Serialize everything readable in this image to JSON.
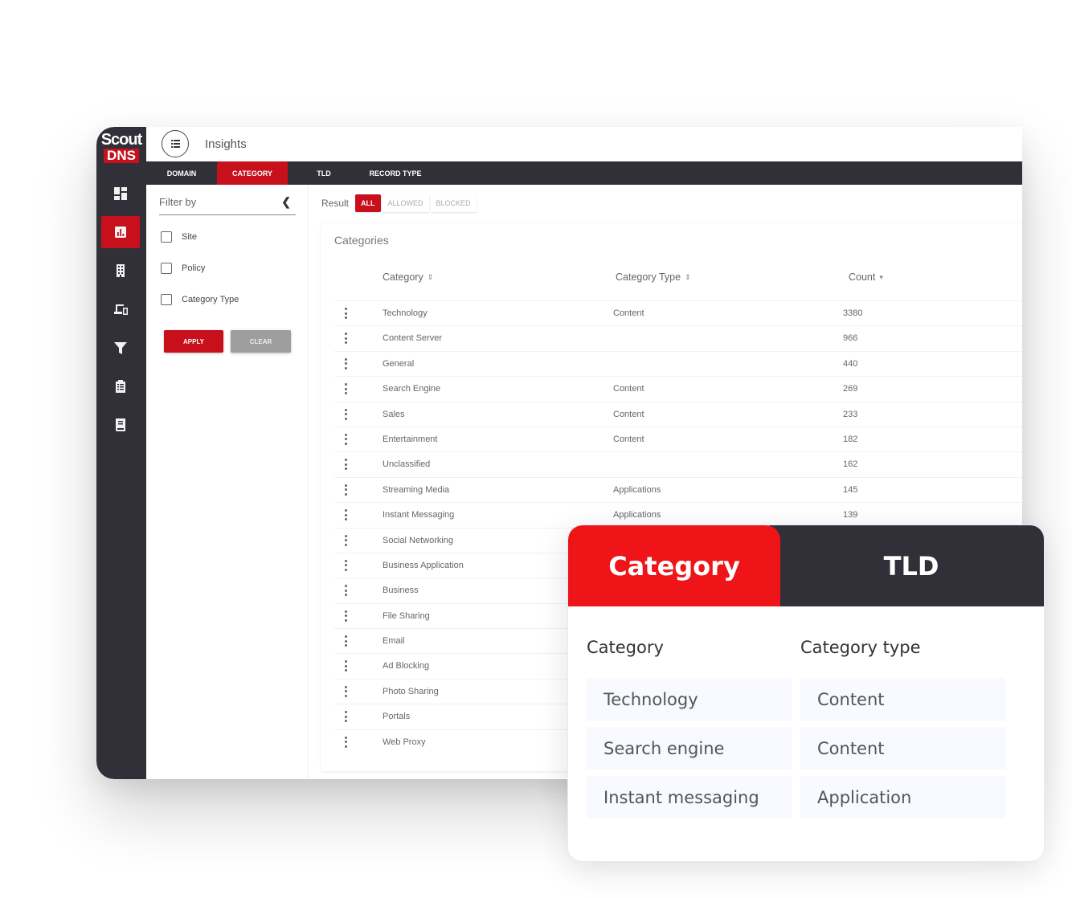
{
  "brand": {
    "name_top": "Scout",
    "name_bottom": "DNS",
    "accent": "#c8101c",
    "dark": "#313038"
  },
  "header": {
    "menu_icon": "list-icon",
    "title": "Insights"
  },
  "tabs": [
    {
      "label": "DOMAIN",
      "active": false
    },
    {
      "label": "CATEGORY",
      "active": true
    },
    {
      "label": "TLD",
      "active": false
    },
    {
      "label": "RECORD TYPE",
      "active": false
    }
  ],
  "sidebar": {
    "items": [
      {
        "icon": "dashboard-icon",
        "active": false
      },
      {
        "icon": "insights-chart-icon",
        "active": true
      },
      {
        "icon": "building-icon",
        "active": false
      },
      {
        "icon": "devices-icon",
        "active": false
      },
      {
        "icon": "filter-icon",
        "active": false
      },
      {
        "icon": "clipboard-list-icon",
        "active": false
      },
      {
        "icon": "book-icon",
        "active": false
      }
    ]
  },
  "filter": {
    "title": "Filter by",
    "collapse_icon": "chevron-left-icon",
    "options": [
      {
        "label": "Site",
        "checked": false
      },
      {
        "label": "Policy",
        "checked": false
      },
      {
        "label": "Category Type",
        "checked": false
      }
    ],
    "apply_label": "APPLY",
    "clear_label": "CLEAR"
  },
  "result": {
    "label": "Result",
    "options": [
      {
        "label": "ALL",
        "active": true
      },
      {
        "label": "ALLOWED",
        "active": false
      },
      {
        "label": "BLOCKED",
        "active": false
      }
    ]
  },
  "categories_table": {
    "title": "Categories",
    "columns": [
      {
        "label": "Category",
        "sort": "⇕"
      },
      {
        "label": "Category Type",
        "sort": "⇕"
      },
      {
        "label": "Count",
        "sort": "▾"
      }
    ],
    "rows": [
      {
        "category": "Technology",
        "type": "Content",
        "count": "3380"
      },
      {
        "category": "Content Server",
        "type": "",
        "count": "966"
      },
      {
        "category": "General",
        "type": "",
        "count": "440"
      },
      {
        "category": "Search Engine",
        "type": "Content",
        "count": "269"
      },
      {
        "category": "Sales",
        "type": "Content",
        "count": "233"
      },
      {
        "category": "Entertainment",
        "type": "Content",
        "count": "182"
      },
      {
        "category": "Unclassified",
        "type": "",
        "count": "162"
      },
      {
        "category": "Streaming Media",
        "type": "Applications",
        "count": "145"
      },
      {
        "category": "Instant Messaging",
        "type": "Applications",
        "count": "139"
      },
      {
        "category": "Social Networking",
        "type": "",
        "count": ""
      },
      {
        "category": "Business Application",
        "type": "",
        "count": ""
      },
      {
        "category": "Business",
        "type": "",
        "count": ""
      },
      {
        "category": "File Sharing",
        "type": "",
        "count": ""
      },
      {
        "category": "Email",
        "type": "",
        "count": ""
      },
      {
        "category": "Ad Blocking",
        "type": "",
        "count": ""
      },
      {
        "category": "Photo Sharing",
        "type": "",
        "count": ""
      },
      {
        "category": "Portals",
        "type": "",
        "count": ""
      },
      {
        "category": "Web Proxy",
        "type": "",
        "count": ""
      }
    ]
  },
  "popup": {
    "tabs": [
      {
        "label": "Category",
        "active": true,
        "color": "#ee1418"
      },
      {
        "label": "TLD",
        "active": false,
        "color": "#313038"
      }
    ],
    "headers": [
      "Category",
      "Category type"
    ],
    "rows": [
      {
        "category": "Technology",
        "type": "Content"
      },
      {
        "category": "Search engine",
        "type": "Content"
      },
      {
        "category": "Instant messaging",
        "type": "Application"
      }
    ]
  }
}
